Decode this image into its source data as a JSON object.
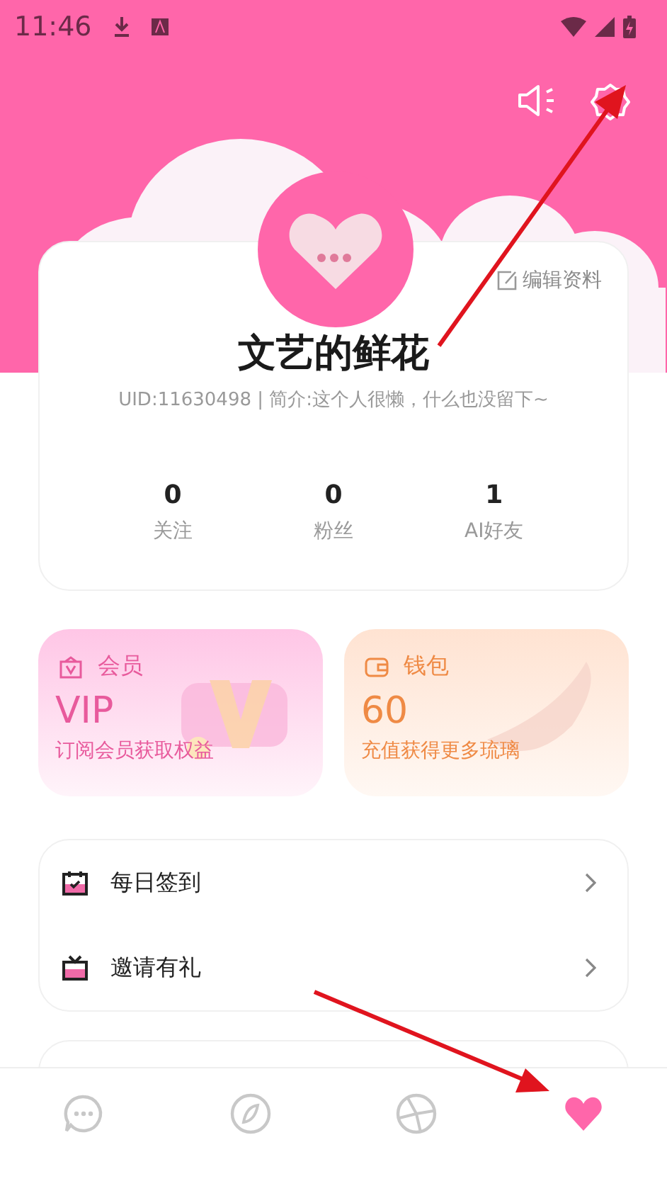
{
  "status_bar": {
    "time": "11:46"
  },
  "profile": {
    "edit_link": "编辑资料",
    "name": "文艺的鲜花",
    "bio": "UID:11630498 | 简介:这个人很懒，什么也没留下~",
    "stats": [
      {
        "value": "0",
        "label": "关注"
      },
      {
        "value": "0",
        "label": "粉丝"
      },
      {
        "value": "1",
        "label": "AI好友"
      }
    ]
  },
  "promo_cards": [
    {
      "kind": "vip",
      "title": "会员",
      "value": "VIP",
      "subtitle": "订阅会员获取权益"
    },
    {
      "kind": "wallet",
      "title": "钱包",
      "value": "60",
      "subtitle": "充值获得更多琉璃"
    }
  ],
  "menu": [
    {
      "kind": "checkin",
      "label": "每日签到"
    },
    {
      "kind": "invite",
      "label": "邀请有礼"
    }
  ],
  "bottom_nav": [
    {
      "kind": "chat",
      "selected": false
    },
    {
      "kind": "discover",
      "selected": false
    },
    {
      "kind": "aperture",
      "selected": false
    },
    {
      "kind": "profile",
      "selected": true
    }
  ]
}
